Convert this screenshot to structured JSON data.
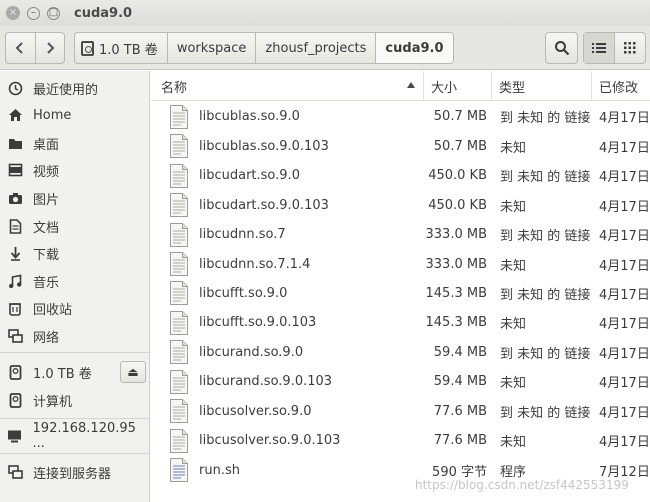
{
  "window": {
    "title": "cuda9.0",
    "close_glyph": "×",
    "min_glyph": "–",
    "max_glyph": "□"
  },
  "toolbar": {
    "back_glyph": "‹",
    "forward_glyph": "›",
    "breadcrumbs": [
      "1.0 TB 卷",
      "workspace",
      "zhousf_projects",
      "cuda9.0"
    ],
    "search_icon": "search-icon",
    "view_list_icon": "list-view-icon",
    "view_grid_icon": "grid-view-icon"
  },
  "sidebar": {
    "places": [
      {
        "label": "最近使用的",
        "icon": "clock-icon"
      },
      {
        "label": "Home",
        "icon": "home-icon"
      },
      {
        "label": "桌面",
        "icon": "folder-icon"
      },
      {
        "label": "视频",
        "icon": "video-icon"
      },
      {
        "label": "图片",
        "icon": "camera-icon"
      },
      {
        "label": "文档",
        "icon": "document-icon"
      },
      {
        "label": "下载",
        "icon": "download-icon"
      },
      {
        "label": "音乐",
        "icon": "music-icon"
      },
      {
        "label": "回收站",
        "icon": "trash-icon"
      },
      {
        "label": "网络",
        "icon": "network-icon"
      }
    ],
    "devices": [
      {
        "label": "1.0 TB 卷",
        "icon": "drive-icon",
        "eject": "⏏"
      },
      {
        "label": "计算机",
        "icon": "drive-icon"
      }
    ],
    "network": [
      {
        "label": "192.168.120.95 ...",
        "icon": "monitor-icon"
      }
    ],
    "connect": {
      "label": "连接到服务器",
      "icon": "connect-server-icon"
    }
  },
  "file_list": {
    "columns": [
      "名称",
      "大小",
      "类型",
      "已修改"
    ],
    "files": [
      {
        "name": "libcublas.so.9.0",
        "size": "50.7 MB",
        "type": "到 未知 的 链接",
        "modified": "4月17日"
      },
      {
        "name": "libcublas.so.9.0.103",
        "size": "50.7 MB",
        "type": "未知",
        "modified": "4月17日"
      },
      {
        "name": "libcudart.so.9.0",
        "size": "450.0 KB",
        "type": "到 未知 的 链接",
        "modified": "4月17日"
      },
      {
        "name": "libcudart.so.9.0.103",
        "size": "450.0 KB",
        "type": "未知",
        "modified": "4月17日"
      },
      {
        "name": "libcudnn.so.7",
        "size": "333.0 MB",
        "type": "到 未知 的 链接",
        "modified": "4月17日"
      },
      {
        "name": "libcudnn.so.7.1.4",
        "size": "333.0 MB",
        "type": "未知",
        "modified": "4月17日"
      },
      {
        "name": "libcufft.so.9.0",
        "size": "145.3 MB",
        "type": "到 未知 的 链接",
        "modified": "4月17日"
      },
      {
        "name": "libcufft.so.9.0.103",
        "size": "145.3 MB",
        "type": "未知",
        "modified": "4月17日"
      },
      {
        "name": "libcurand.so.9.0",
        "size": "59.4 MB",
        "type": "到 未知 的 链接",
        "modified": "4月17日"
      },
      {
        "name": "libcurand.so.9.0.103",
        "size": "59.4 MB",
        "type": "未知",
        "modified": "4月17日"
      },
      {
        "name": "libcusolver.so.9.0",
        "size": "77.6 MB",
        "type": "到 未知 的 链接",
        "modified": "4月17日"
      },
      {
        "name": "libcusolver.so.9.0.103",
        "size": "77.6 MB",
        "type": "未知",
        "modified": "4月17日"
      },
      {
        "name": "run.sh",
        "size": "590 字节",
        "type": "程序",
        "modified": "7月12日"
      }
    ]
  },
  "watermark": "https://blog.csdn.net/zsf442553199"
}
